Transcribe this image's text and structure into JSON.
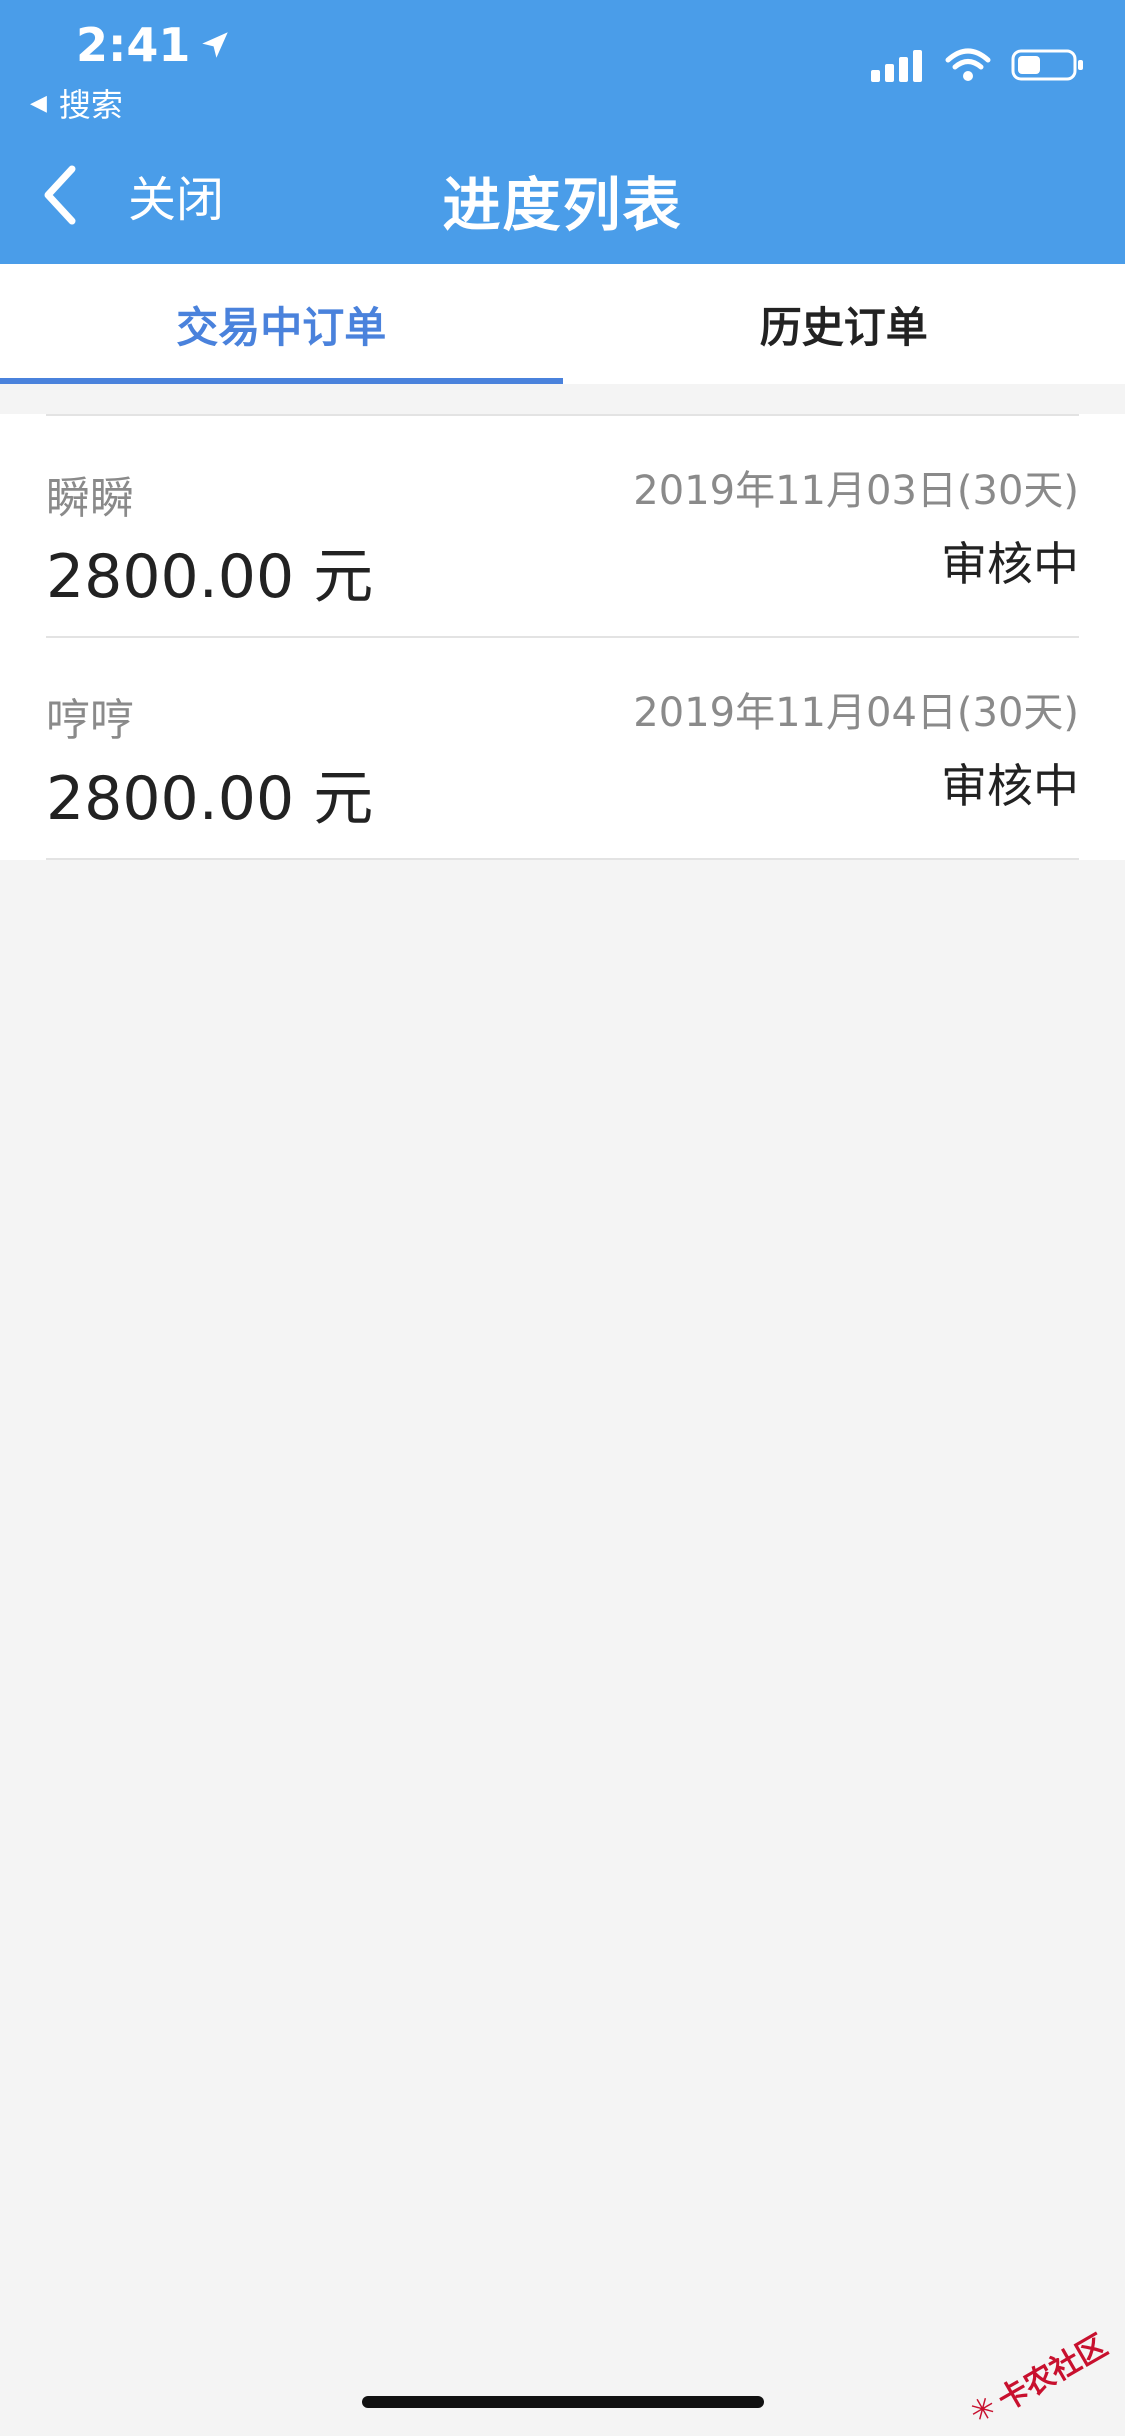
{
  "status_bar": {
    "time": "2:41",
    "back_app": "搜索"
  },
  "nav": {
    "back_label": "关闭",
    "title": "进度列表"
  },
  "tabs": [
    {
      "label": "交易中订单",
      "active": true
    },
    {
      "label": "历史订单",
      "active": false
    }
  ],
  "orders": [
    {
      "name": "瞬瞬",
      "amount": "2800.00 元",
      "date": "2019年11月03日(30天)",
      "status": "审核中"
    },
    {
      "name": "哼哼",
      "amount": "2800.00 元",
      "date": "2019年11月04日(30天)",
      "status": "审核中"
    }
  ],
  "watermark": "卡农社区",
  "colors": {
    "header_bg": "#4a9de9",
    "accent": "#4a82dc",
    "page_bg": "#f4f4f4"
  }
}
